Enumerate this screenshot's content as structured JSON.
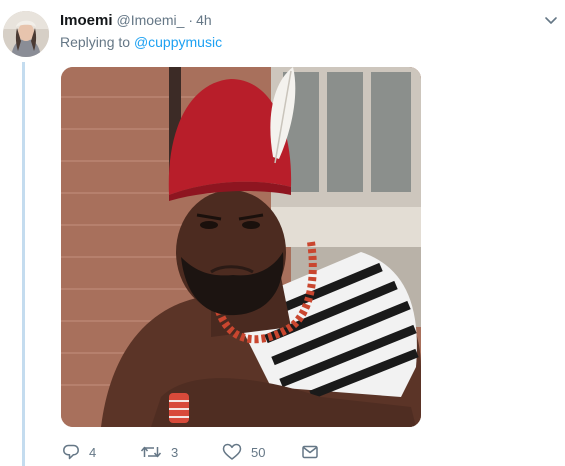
{
  "tweet": {
    "display_name": "Imoemi",
    "handle": "@Imoemi_",
    "separator": "·",
    "time": "4h",
    "replying_prefix": "Replying to ",
    "replying_to": "@cuppymusic",
    "media_alt": "Man in a red cap and striped garment looking displeased"
  },
  "actions": {
    "reply_count": "4",
    "retweet_count": "3",
    "like_count": "50"
  },
  "colors": {
    "link": "#1da1f2",
    "secondary_text": "#657786",
    "thread_line": "#c4dcef"
  },
  "icons": {
    "menu": "chevron-down-icon",
    "reply": "reply-icon",
    "retweet": "retweet-icon",
    "like": "heart-icon",
    "dm": "envelope-icon"
  }
}
